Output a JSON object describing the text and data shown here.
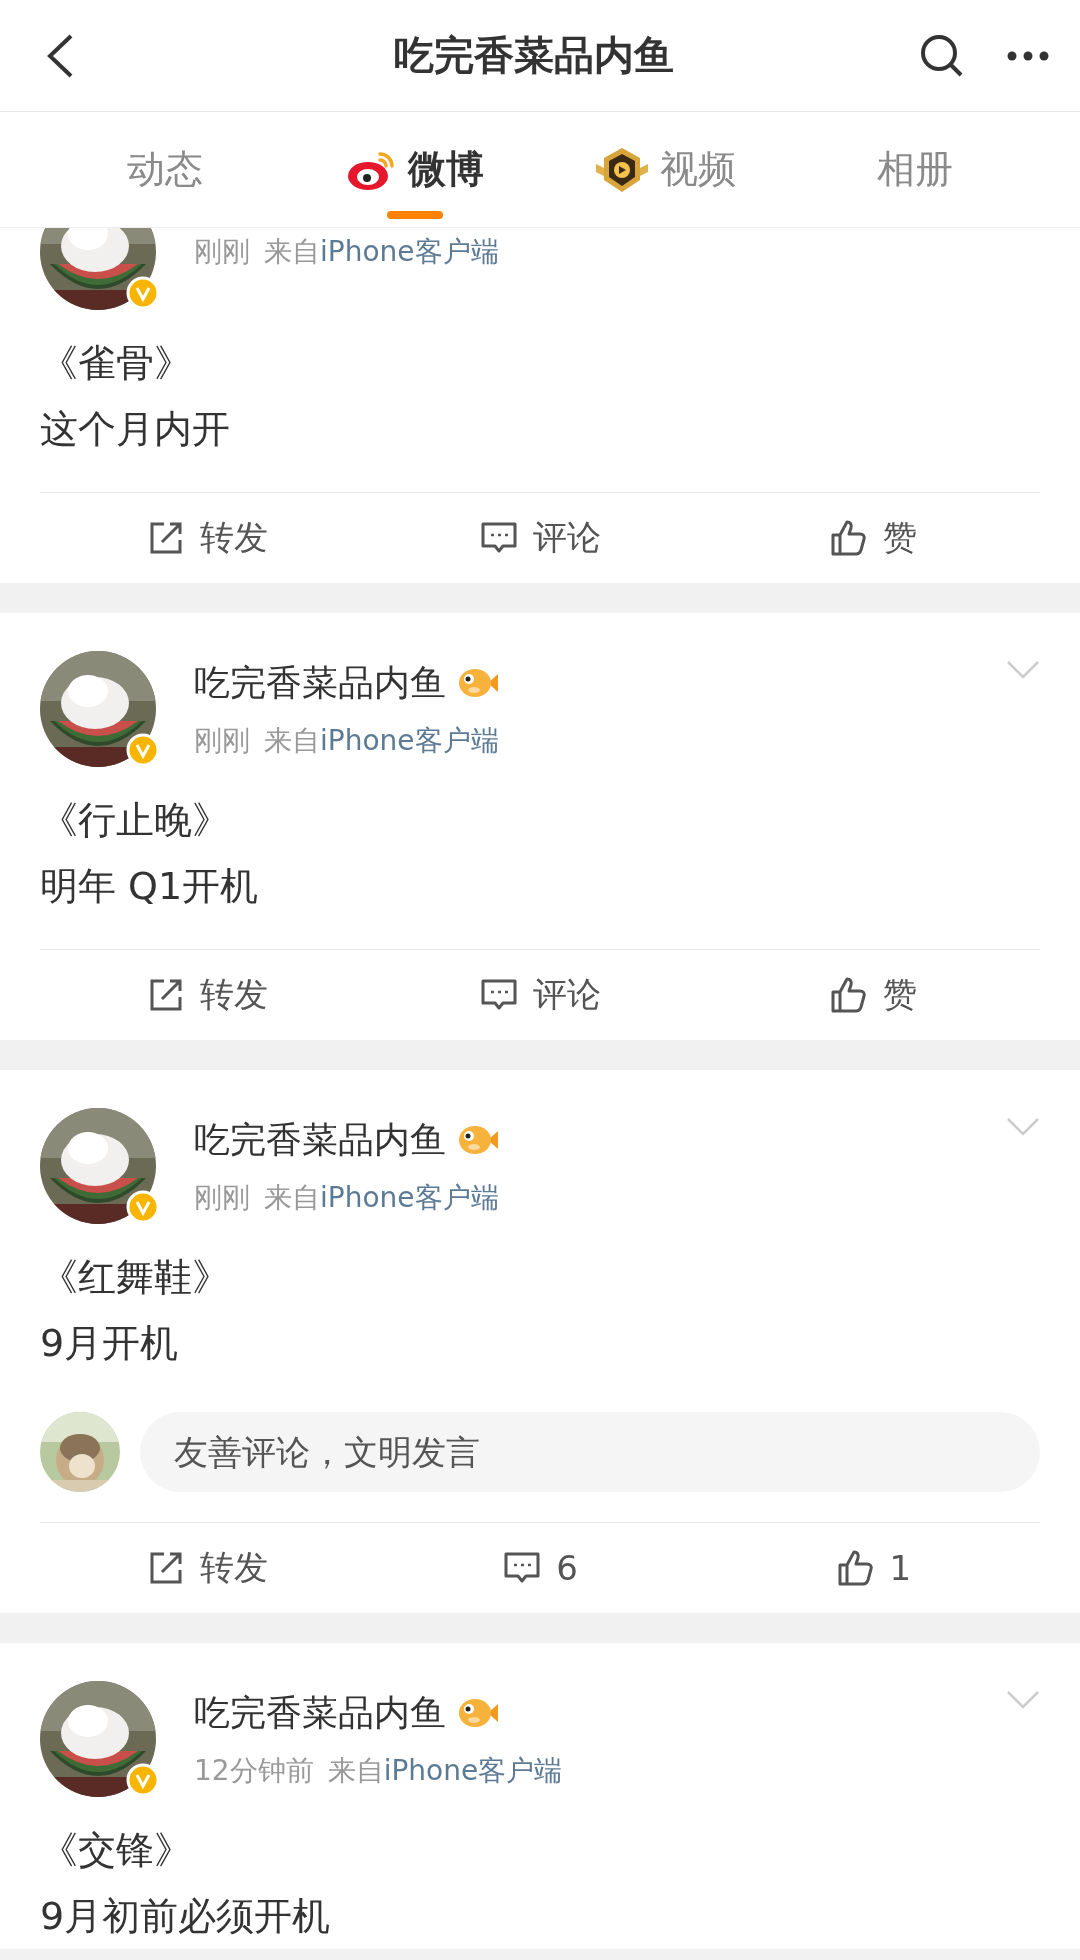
{
  "nav": {
    "title": "吃完香菜品内鱼"
  },
  "tabs": [
    {
      "label": "动态",
      "selected": false,
      "kind": "plain"
    },
    {
      "label": "微博",
      "selected": true,
      "kind": "weibo"
    },
    {
      "label": "视频",
      "selected": false,
      "kind": "video"
    },
    {
      "label": "相册",
      "selected": false,
      "kind": "plain"
    }
  ],
  "posts": [
    {
      "cropped": true,
      "time": "刚刚",
      "source_prefix": "来自",
      "source": "iPhone客户端",
      "title": "《雀骨》",
      "text": "这个月内开",
      "actions": [
        {
          "kind": "repost",
          "label": "转发"
        },
        {
          "kind": "comment",
          "label": "评论"
        },
        {
          "kind": "like",
          "label": "赞"
        }
      ]
    },
    {
      "cropped": false,
      "name": "吃完香菜品内鱼",
      "time": "刚刚",
      "source_prefix": "来自",
      "source": "iPhone客户端",
      "title": "《行止晚》",
      "text": "明年 Q1开机",
      "actions": [
        {
          "kind": "repost",
          "label": "转发"
        },
        {
          "kind": "comment",
          "label": "评论"
        },
        {
          "kind": "like",
          "label": "赞"
        }
      ]
    },
    {
      "cropped": false,
      "name": "吃完香菜品内鱼",
      "time": "刚刚",
      "source_prefix": "来自",
      "source": "iPhone客户端",
      "title": "《红舞鞋》",
      "text": "9月开机",
      "comment_box": {
        "placeholder": "友善评论，文明发言"
      },
      "actions": [
        {
          "kind": "repost",
          "label": "转发"
        },
        {
          "kind": "comment",
          "label": "6"
        },
        {
          "kind": "like",
          "label": "1"
        }
      ]
    },
    {
      "cropped": false,
      "name": "吃完香菜品内鱼",
      "time": "12分钟前",
      "source_prefix": "来自",
      "source": "iPhone客户端",
      "title": "《交锋》",
      "text": "9月初前必须开机"
    }
  ]
}
